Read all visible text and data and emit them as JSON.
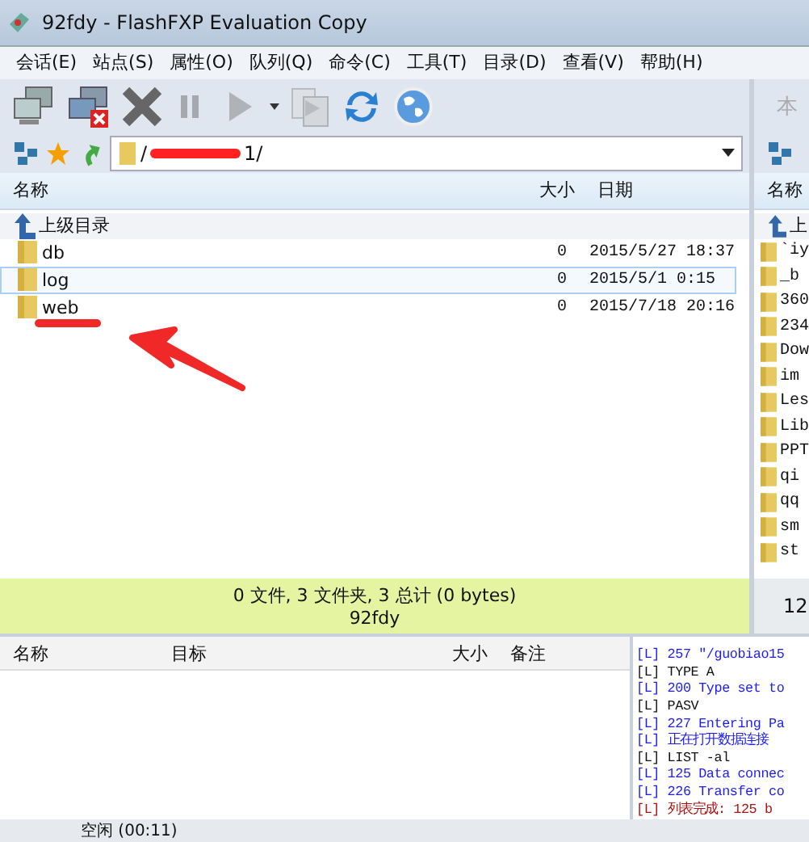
{
  "window": {
    "title": "92fdy - FlashFXP Evaluation Copy"
  },
  "menu": [
    "会话(E)",
    "站点(S)",
    "属性(O)",
    "队列(Q)",
    "命令(C)",
    "工具(T)",
    "目录(D)",
    "查看(V)",
    "帮助(H)"
  ],
  "toolbar": [
    {
      "kind": "connect",
      "disabled": false
    },
    {
      "kind": "disconnect",
      "disabled": false
    },
    {
      "kind": "abort",
      "disabled": false
    },
    {
      "kind": "pause",
      "disabled": true
    },
    {
      "kind": "play",
      "disabled": true
    },
    {
      "kind": "caret",
      "disabled": false
    },
    {
      "kind": "transfer",
      "disabled": true
    },
    {
      "kind": "refresh",
      "disabled": false
    },
    {
      "kind": "globe",
      "disabled": false
    }
  ],
  "left_panel": {
    "path_start": "/",
    "path_end": "1/",
    "columns": [
      "名称",
      "大小",
      "日期"
    ],
    "parent_row": "上级目录",
    "rows": [
      {
        "name": "db",
        "size": "0",
        "date": "2015/5/27 18:37",
        "selected": false
      },
      {
        "name": "log",
        "size": "0",
        "date": "2015/5/1 0:15",
        "selected": true
      },
      {
        "name": "web",
        "size": "0",
        "date": "2015/7/18 20:16",
        "selected": false
      }
    ],
    "status": "0 文件, 3 文件夹, 3 总计 (0 bytes)",
    "site": "92fdy"
  },
  "right_panel": {
    "title": "本",
    "column": "名称",
    "parent_row": "上",
    "rows": [
      "`iy",
      "_b",
      "360",
      "234",
      "Dow",
      "im",
      "Les",
      "Lib",
      "PPT",
      "qi",
      "qq",
      "sm",
      "st"
    ],
    "status": "12"
  },
  "queue": {
    "columns": [
      "名称",
      "目标",
      "大小",
      "备注"
    ]
  },
  "log": [
    {
      "kind": "reply",
      "text": "[L] 257 \"/guobiao15"
    },
    {
      "kind": "command",
      "text": "[L] TYPE A"
    },
    {
      "kind": "reply",
      "text": "[L] 200 Type set to"
    },
    {
      "kind": "command",
      "text": "[L] PASV"
    },
    {
      "kind": "reply",
      "text": "[L] 227 Entering Pa"
    },
    {
      "kind": "reply",
      "text": "[L] 正在打开数据连接"
    },
    {
      "kind": "command",
      "text": "[L] LIST -al"
    },
    {
      "kind": "reply",
      "text": "[L] 125 Data connec"
    },
    {
      "kind": "reply",
      "text": "[L] 226 Transfer co"
    },
    {
      "kind": "done",
      "text": "[L] 列表完成: 125 b"
    }
  ],
  "status_bar": {
    "text": "空闲 (00:11)"
  }
}
